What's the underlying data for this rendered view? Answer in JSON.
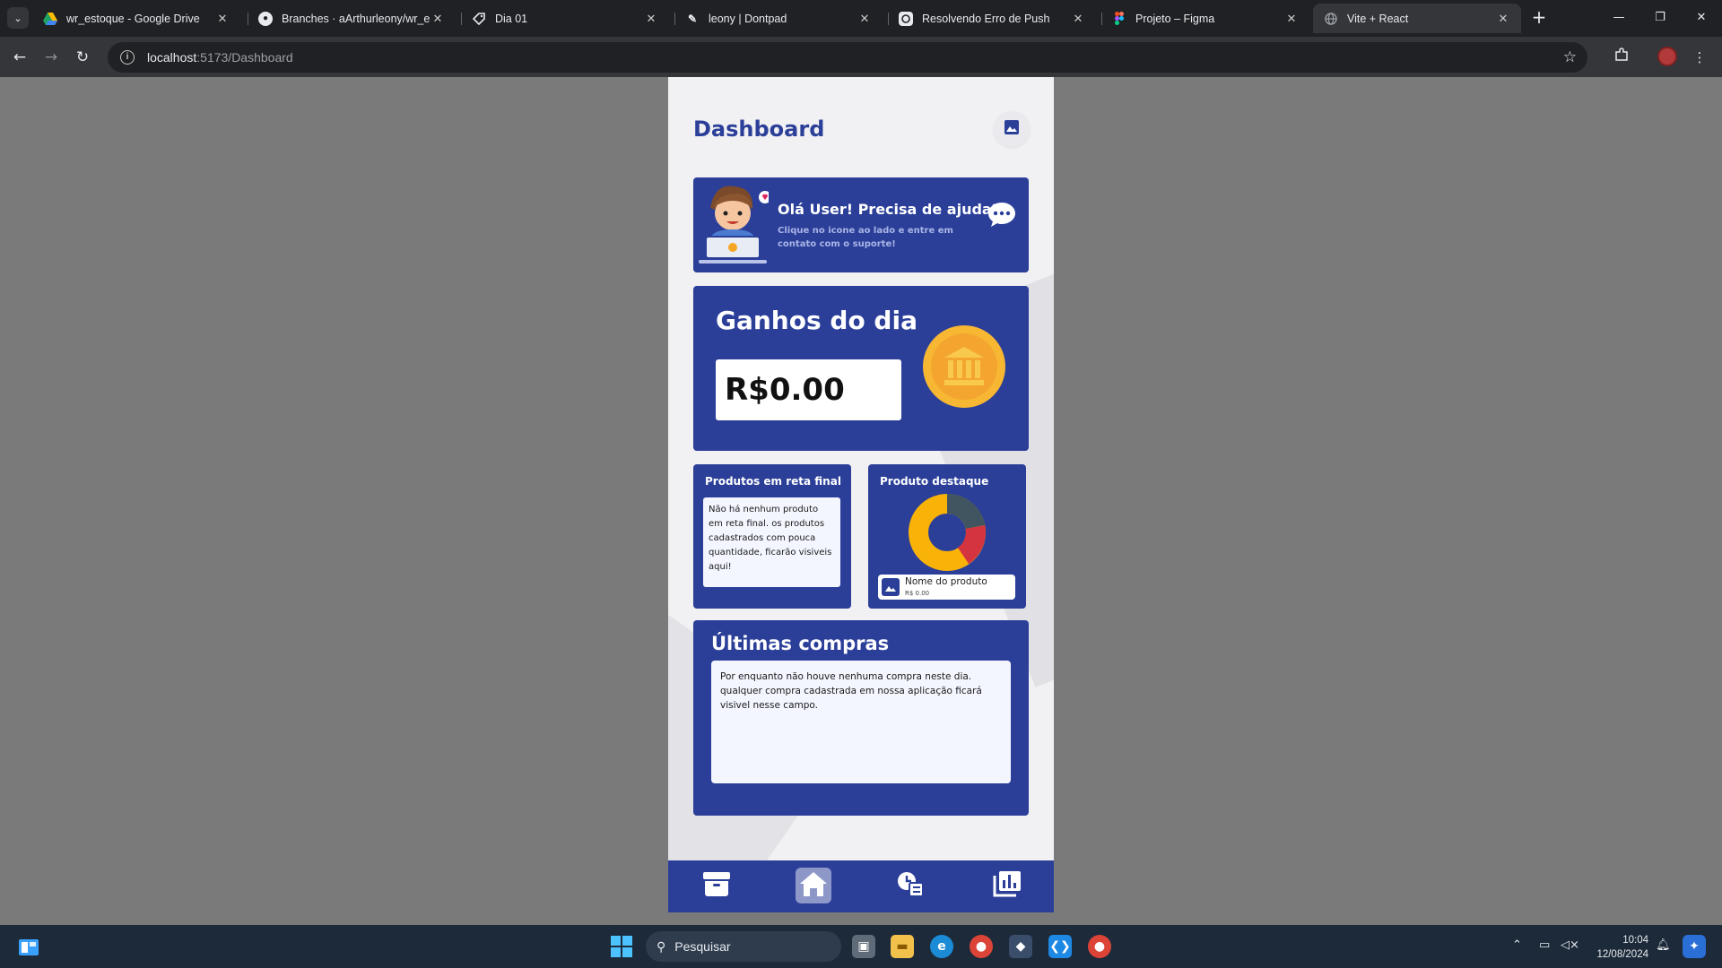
{
  "browser": {
    "tabs": [
      {
        "title": "wr_estoque - Google Drive",
        "icon": "google-drive-icon"
      },
      {
        "title": "Branches · aArthurleony/wr_esto",
        "icon": "github-icon"
      },
      {
        "title": "Dia 01",
        "icon": "tag-icon"
      },
      {
        "title": "leony | Dontpad",
        "icon": "dontpad-icon"
      },
      {
        "title": "Resolvendo Erro de Push",
        "icon": "chatgpt-icon"
      },
      {
        "title": "Projeto – Figma",
        "icon": "figma-icon"
      },
      {
        "title": "Vite + React",
        "icon": "globe-icon",
        "active": true
      }
    ],
    "url_host": "localhost",
    "url_path": ":5173/Dashboard"
  },
  "app": {
    "page_title": "Dashboard",
    "help": {
      "title": "Olá User! Precisa de ajuda?",
      "subtitle": "Clique no icone ao lado e entre em contato com o suporte!"
    },
    "earnings": {
      "title": "Ganhos do dia",
      "value": "R$0.00"
    },
    "final_products": {
      "title": "Produtos em reta final",
      "message": "Não há nenhum produto em reta final. os produtos cadastrados com pouca quantidade, ficarão visiveis aqui!"
    },
    "featured": {
      "title": "Produto destaque",
      "product_name": "Nome do produto",
      "product_price": "R$ 0.00"
    },
    "last_purchases": {
      "title": "Últimas compras",
      "message": "Por enquanto não houve nenhuma compra neste dia. qualquer compra cadastrada em nossa aplicação ficará visivel nesse campo."
    },
    "colors": {
      "primary": "#2b3f99",
      "coin": "#f7b733",
      "donut_yellow": "#f9b208",
      "donut_dark": "#40555f",
      "donut_red": "#d4343f"
    }
  },
  "taskbar": {
    "search_placeholder": "Pesquisar",
    "time": "10:04",
    "date": "12/08/2024"
  }
}
